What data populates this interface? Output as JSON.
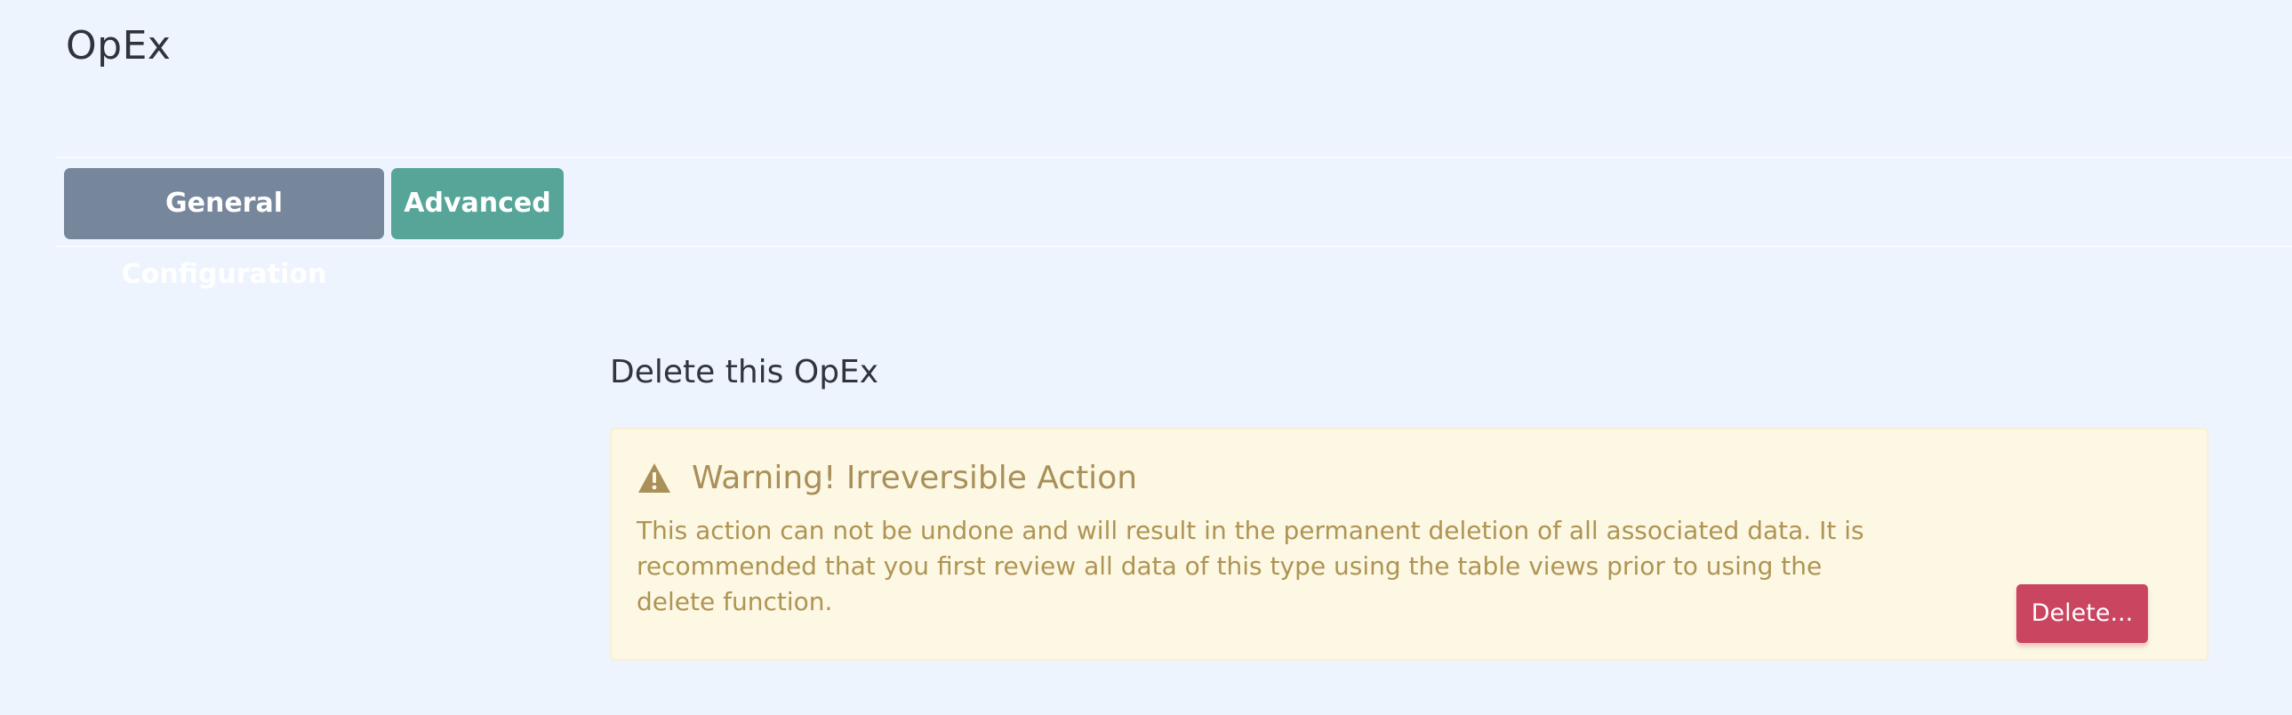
{
  "page": {
    "title": "OpEx"
  },
  "tabs": [
    {
      "label": "General Configuration",
      "color": "#76869b"
    },
    {
      "label": "Advanced",
      "color": "#56a598"
    }
  ],
  "delete_section": {
    "title": "Delete this OpEx",
    "warning": {
      "icon": "warning-triangle-icon",
      "title": "Warning! Irreversible Action",
      "message": "This action can not be undone and will result in the permanent deletion of all associated data. It is recommended that you first review all data of this type using the table views prior to using the delete function.",
      "background_color": "#fcf8e4",
      "text_color": "#af9453"
    },
    "delete_button_label": "Delete...",
    "delete_button_color": "#c94560"
  }
}
